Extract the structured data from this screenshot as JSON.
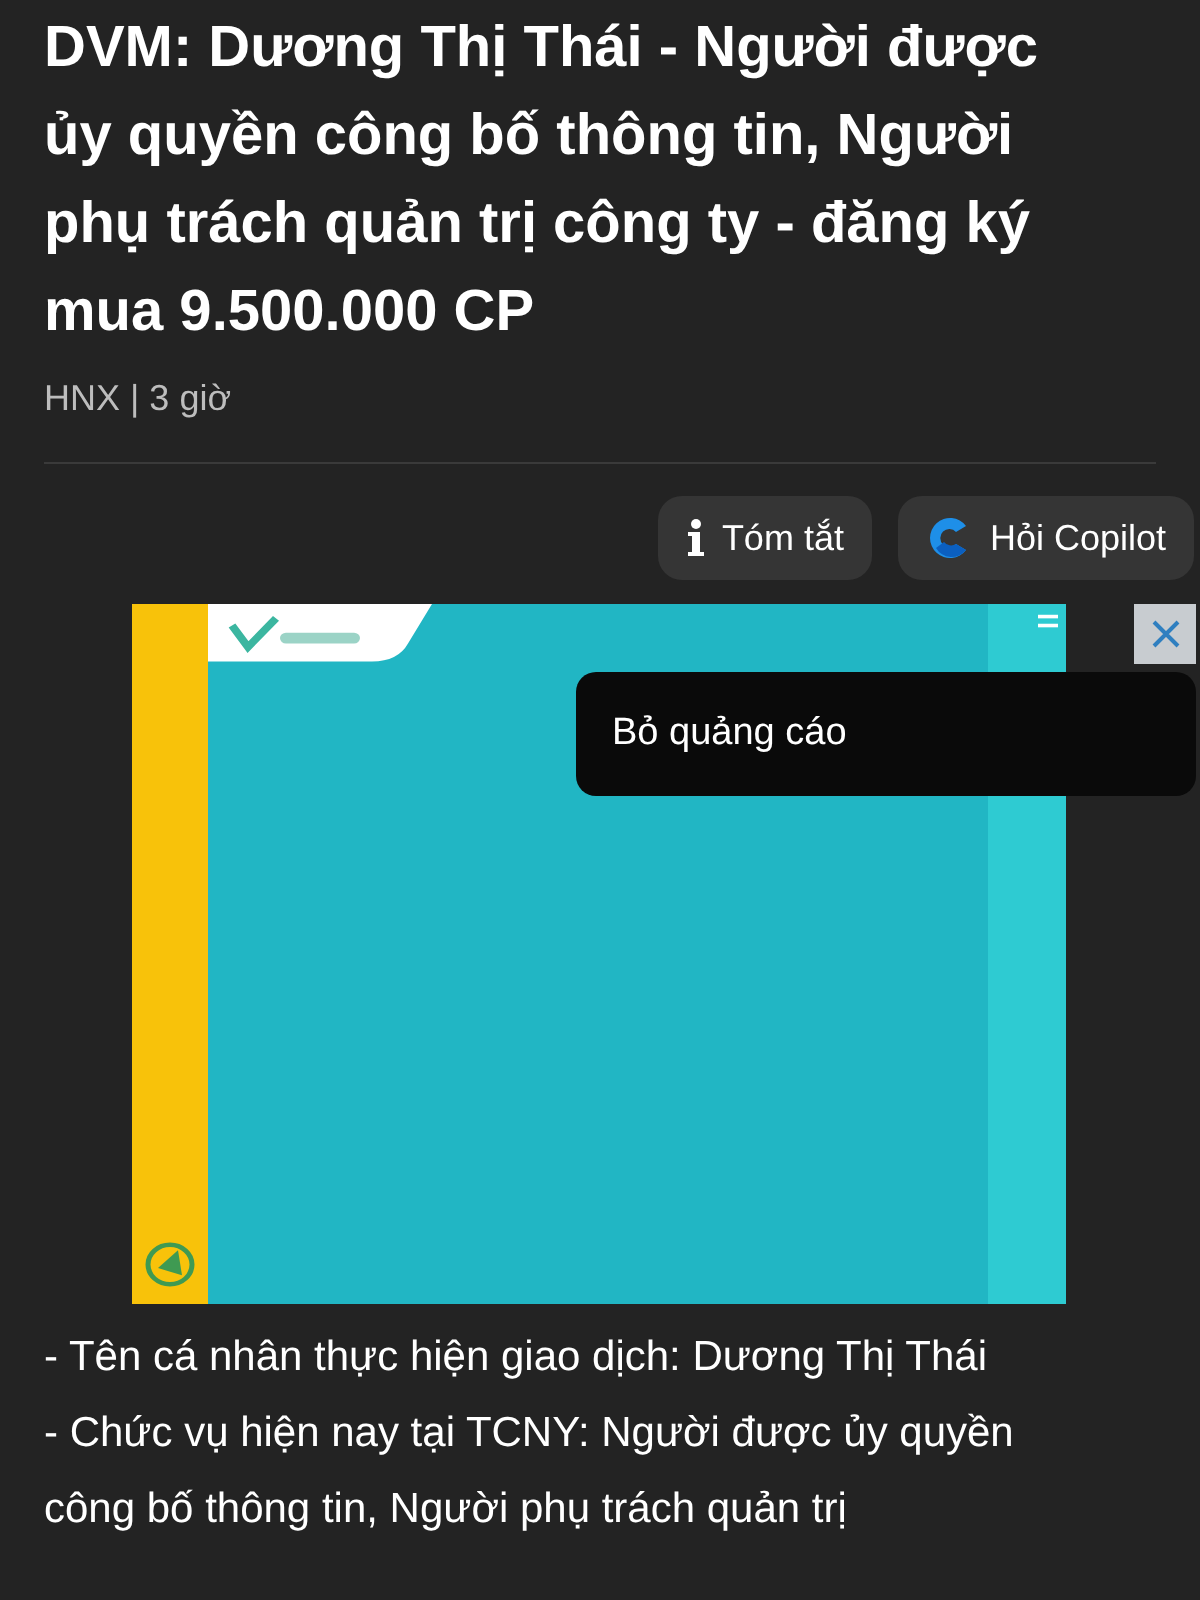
{
  "article": {
    "title": "DVM: Dương Thị Thái - Người được ủy quyền công bố thông tin, Người phụ trách quản trị công ty - đăng ký mua 9.500.000 CP",
    "meta": "HNX | 3 giờ"
  },
  "actions": [
    {
      "kind": "summary",
      "label": "Tóm tắt"
    },
    {
      "kind": "copilot",
      "label": "Hỏi Copilot"
    }
  ],
  "ad": {
    "menu": {
      "label": "Bỏ quảng cáo"
    }
  },
  "body": [
    "- Tên cá nhân thực hiện giao dịch: Dương Thị Thái",
    "- Chức vụ hiện nay tại TCNY: Người được ủy quyền công bố thông tin, Người phụ trách quản trị"
  ]
}
